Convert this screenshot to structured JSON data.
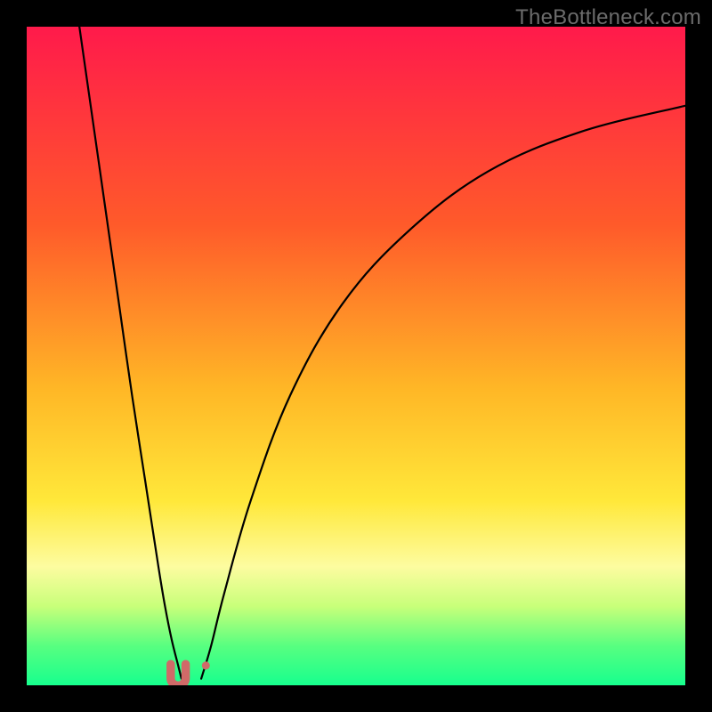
{
  "watermark": "TheBottleneck.com",
  "chart_data": {
    "type": "line",
    "title": "",
    "xlabel": "",
    "ylabel": "",
    "xlim": [
      0,
      100
    ],
    "ylim": [
      0,
      100
    ],
    "grid": false,
    "legend": false,
    "gradient_stops": [
      {
        "offset": 0,
        "color": "#ff1a4b"
      },
      {
        "offset": 30,
        "color": "#ff5a2a"
      },
      {
        "offset": 55,
        "color": "#ffb726"
      },
      {
        "offset": 72,
        "color": "#ffe83a"
      },
      {
        "offset": 82,
        "color": "#fdfca0"
      },
      {
        "offset": 88,
        "color": "#c8ff7a"
      },
      {
        "offset": 94,
        "color": "#58ff80"
      },
      {
        "offset": 100,
        "color": "#17ff8e"
      }
    ],
    "series": [
      {
        "name": "left-branch",
        "x": [
          8,
          10,
          12,
          14,
          16,
          18,
          20,
          21,
          22,
          23,
          23.5
        ],
        "values": [
          100,
          86,
          72,
          58,
          44,
          31,
          18,
          12,
          7,
          3,
          1
        ]
      },
      {
        "name": "right-branch",
        "x": [
          26.5,
          28,
          30,
          34,
          40,
          48,
          58,
          70,
          84,
          100
        ],
        "values": [
          1,
          6,
          14,
          28,
          44,
          58,
          69,
          78,
          84,
          88
        ]
      }
    ],
    "markers": [
      {
        "name": "valley-u",
        "shape": "u",
        "x": 23.0,
        "y": 1.6,
        "color": "#d06a68",
        "size": 7
      },
      {
        "name": "valley-dot",
        "shape": "dot",
        "x": 27.2,
        "y": 3.0,
        "color": "#d06a68",
        "size": 4.5
      }
    ]
  }
}
